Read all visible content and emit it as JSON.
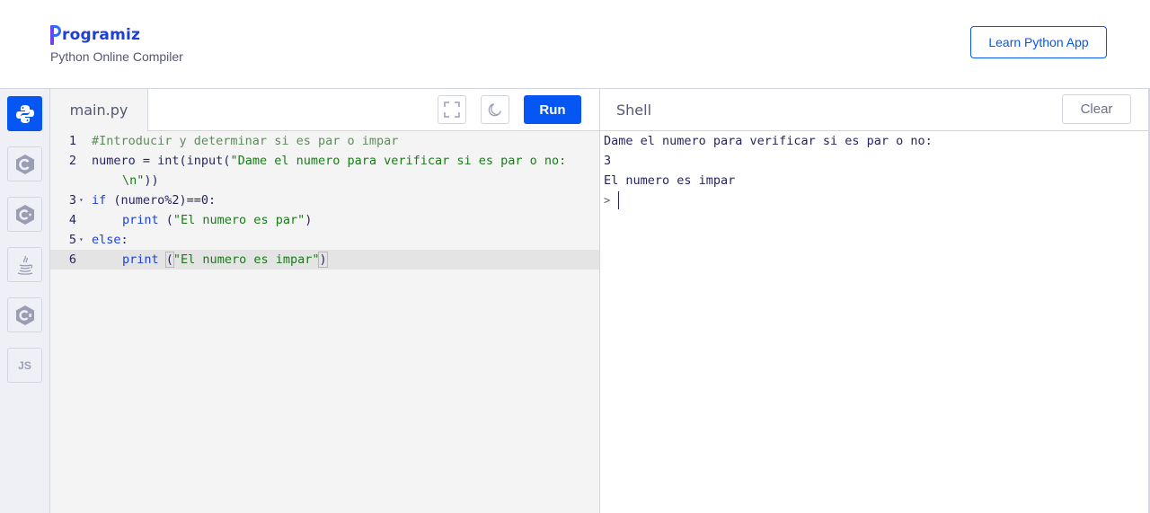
{
  "header": {
    "logo_text": "rogramiz",
    "subtitle": "Python Online Compiler",
    "learn_button": "Learn Python App"
  },
  "languages": [
    {
      "name": "python",
      "icon": "python-icon",
      "active": true
    },
    {
      "name": "c",
      "icon": "c-icon",
      "active": false
    },
    {
      "name": "cpp",
      "icon": "cpp-icon",
      "active": false
    },
    {
      "name": "java",
      "icon": "java-icon",
      "active": false
    },
    {
      "name": "csharp",
      "icon": "csharp-icon",
      "active": false
    },
    {
      "name": "javascript",
      "icon": "js-icon",
      "label": "JS",
      "active": false
    }
  ],
  "editor": {
    "file_tab": "main.py",
    "run_label": "Run",
    "lines": [
      {
        "num": "1",
        "text": "#Introducir y determinar si es par o impar"
      },
      {
        "num": "2",
        "text_a": "numero = int(input(",
        "text_b": "\"Dame el numero para verificar si es par o no:",
        "text_c": "\\n\"",
        "text_d": "))"
      },
      {
        "num": "3",
        "kw": "if",
        "text": " (numero%2)==0:"
      },
      {
        "num": "4",
        "kw": "print",
        "text_a": " (",
        "str": "\"El numero es par\"",
        "text_b": ")"
      },
      {
        "num": "5",
        "kw": "else",
        "text": ":"
      },
      {
        "num": "6",
        "kw": "print",
        "text_a": " ",
        "paren_open": "(",
        "str": "\"El numero es impar\"",
        "paren_close": ")"
      }
    ]
  },
  "shell": {
    "title": "Shell",
    "clear_label": "Clear",
    "output": [
      "Dame el numero para verificar si es par o no:",
      "3",
      "El numero es impar"
    ],
    "prompt": ">"
  },
  "colors": {
    "accent": "#0556f3",
    "editor_bg": "#f4f4f4",
    "highlight_line": "#e4e4e4"
  }
}
